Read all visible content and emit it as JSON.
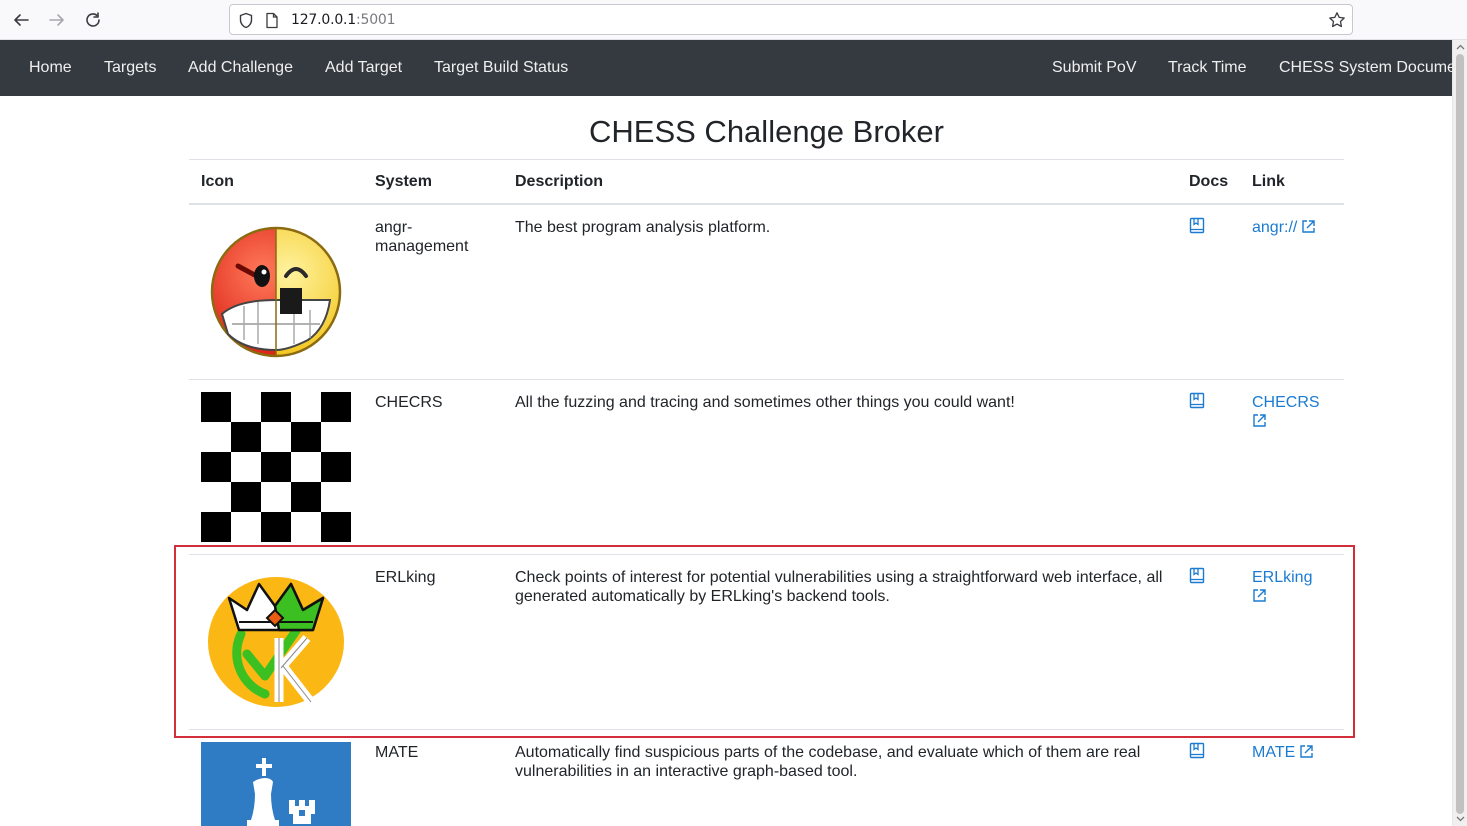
{
  "browser": {
    "url_host": "127.0.0.1",
    "url_port": ":5001",
    "icons": [
      "back-arrow-icon",
      "forward-arrow-icon",
      "reload-icon",
      "shield-icon",
      "page-icon",
      "star-icon"
    ]
  },
  "navbar": {
    "left": [
      "Home",
      "Targets",
      "Add Challenge",
      "Add Target",
      "Target Build Status"
    ],
    "right": [
      "Submit PoV",
      "Track Time",
      "CHESS System Documentation"
    ]
  },
  "page": {
    "title": "CHESS Challenge Broker"
  },
  "table": {
    "headers": {
      "icon": "Icon",
      "system": "System",
      "description": "Description",
      "docs": "Docs",
      "link": "Link"
    },
    "rows": [
      {
        "icon": "angr-face-icon",
        "system": "angr-management",
        "description": "The best program analysis platform.",
        "link": "angr://"
      },
      {
        "icon": "checkerboard-icon",
        "system": "CHECRS",
        "description": "All the fuzzing and tracing and sometimes other things you could want!",
        "link": "CHECRS"
      },
      {
        "icon": "erlking-crown-icon",
        "system": "ERLking",
        "description": "Check points of interest for potential vulnerabilities using a straightforward web interface, all generated automatically by ERLking's backend tools.",
        "link": "ERLking",
        "highlighted": true
      },
      {
        "icon": "mate-chess-icon",
        "system": "MATE",
        "description": "Automatically find suspicious parts of the codebase, and evaluate which of them are real vulnerabilities in an interactive graph-based tool.",
        "link": "MATE"
      }
    ]
  },
  "colors": {
    "navbar": "#343a40",
    "link": "#1a7bd1",
    "highlight": "#d32f3a"
  }
}
